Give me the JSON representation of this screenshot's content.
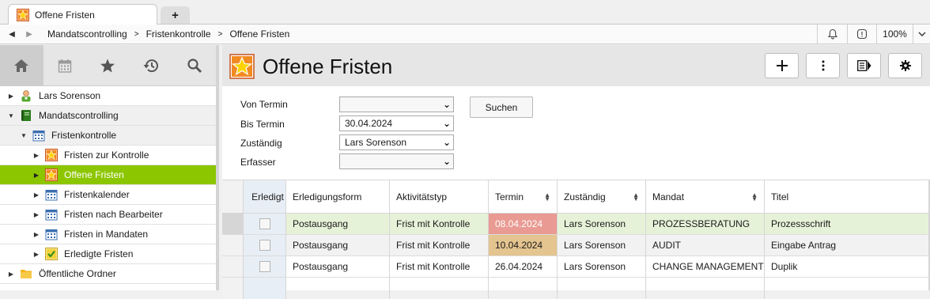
{
  "tab": {
    "title": "Offene Fristen",
    "new_tab": "+"
  },
  "breadcrumb": {
    "items": [
      "Mandatscontrolling",
      "Fristenkontrolle",
      "Offene Fristen"
    ],
    "zoom": "100%"
  },
  "sidebar": {
    "tree": [
      {
        "label": "Lars Sorenson",
        "level": 0,
        "icon": "user-icon"
      },
      {
        "label": "Mandatscontrolling",
        "level": 0,
        "icon": "book-icon"
      },
      {
        "label": "Fristenkontrolle",
        "level": 1,
        "icon": "calendar-icon"
      },
      {
        "label": "Fristen zur Kontrolle",
        "level": 2,
        "icon": "star-icon"
      },
      {
        "label": "Offene Fristen",
        "level": 2,
        "icon": "star-icon",
        "selected": true
      },
      {
        "label": "Fristenkalender",
        "level": 2,
        "icon": "calendar-icon"
      },
      {
        "label": "Fristen nach Bearbeiter",
        "level": 2,
        "icon": "calendar-icon"
      },
      {
        "label": "Fristen in Mandaten",
        "level": 2,
        "icon": "calendar-icon"
      },
      {
        "label": "Erledigte Fristen",
        "level": 2,
        "icon": "check-icon"
      },
      {
        "label": "Öffentliche Ordner",
        "level": 0,
        "icon": "folder-icon"
      }
    ]
  },
  "page": {
    "title": "Offene Fristen"
  },
  "filter": {
    "von_label": "Von Termin",
    "von_value": "",
    "bis_label": "Bis Termin",
    "bis_value": "30.04.2024",
    "zust_label": "Zuständig",
    "zust_value": "Lars Sorenson",
    "erf_label": "Erfasser",
    "erf_value": "",
    "search_label": "Suchen"
  },
  "grid": {
    "columns": [
      "Erledigt",
      "Erledigungsform",
      "Aktivitätstyp",
      "Termin",
      "Zuständig",
      "Mandat",
      "Titel"
    ],
    "rows": [
      {
        "form": "Postausgang",
        "typ": "Frist mit Kontrolle",
        "termin": "08.04.2024",
        "zust": "Lars Sorenson",
        "mandat": "PROZESSBERATUNG",
        "titel": "Prozessschrift"
      },
      {
        "form": "Postausgang",
        "typ": "Frist mit Kontrolle",
        "termin": "10.04.2024",
        "zust": "Lars Sorenson",
        "mandat": "AUDIT",
        "titel": "Eingabe Antrag"
      },
      {
        "form": "Postausgang",
        "typ": "Frist mit Kontrolle",
        "termin": "26.04.2024",
        "zust": "Lars Sorenson",
        "mandat": "CHANGE MANAGEMENT",
        "titel": "Duplik"
      }
    ]
  },
  "colors": {
    "selected_green": "#8cc600",
    "overdue_red": "#e99a92",
    "warning_amber": "#e4c48f",
    "highlight_row": "#e6f2d8"
  }
}
